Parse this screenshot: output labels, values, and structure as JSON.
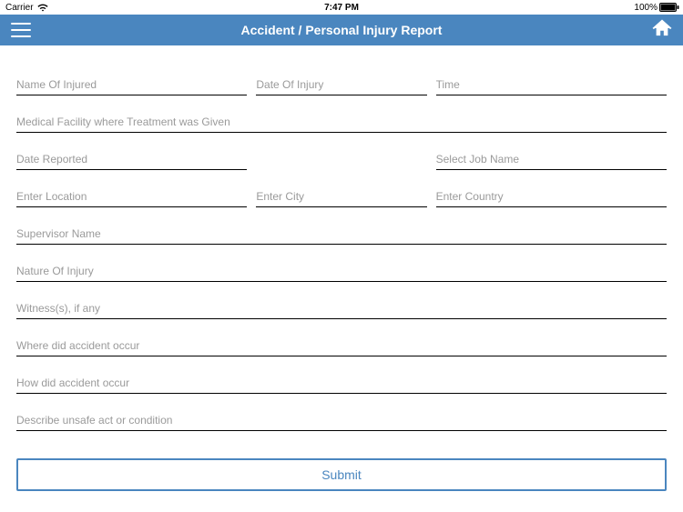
{
  "status_bar": {
    "carrier": "Carrier",
    "time": "7:47 PM",
    "battery_pct": "100%"
  },
  "nav": {
    "title": "Accident / Personal Injury Report"
  },
  "form": {
    "name_of_injured": "Name Of Injured",
    "date_of_injury": "Date Of Injury",
    "time": "Time",
    "medical_facility": "Medical Facility where Treatment was Given",
    "date_reported": "Date Reported",
    "select_job_name": "Select Job Name",
    "enter_location": "Enter Location",
    "enter_city": "Enter City",
    "enter_country": "Enter Country",
    "supervisor_name": "Supervisor Name",
    "nature_of_injury": "Nature Of Injury",
    "witness": "Witness(s), if any",
    "where_accident": "Where did accident occur",
    "how_accident": "How did accident occur",
    "describe_unsafe": "Describe unsafe act or condition",
    "submit_label": "Submit"
  }
}
